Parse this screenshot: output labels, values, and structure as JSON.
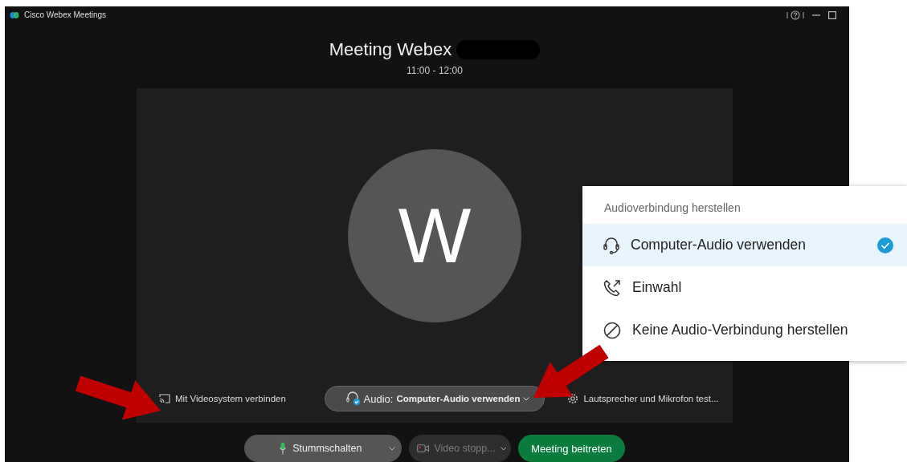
{
  "window": {
    "title": "Cisco Webex Meetings"
  },
  "meeting": {
    "title": "Meeting Webex",
    "time": "11:00 - 12:00"
  },
  "avatar": {
    "initial": "W"
  },
  "preview_bar": {
    "video_system": "Mit Videosystem verbinden",
    "audio": {
      "label": "Audio:",
      "value": "Computer-Audio verwenden"
    },
    "test": "Lautsprecher und Mikrofon test..."
  },
  "actions": [
    {
      "kind": "mute",
      "label": "Stummschalten",
      "disabled": false
    },
    {
      "kind": "video",
      "label": "Video stopp...",
      "disabled": true
    },
    {
      "kind": "join",
      "label": "Meeting beitreten",
      "disabled": false
    }
  ],
  "audio_menu": {
    "title": "Audioverbindung herstellen",
    "options": [
      {
        "kind": "computer",
        "label": "Computer-Audio verwenden",
        "selected": true
      },
      {
        "kind": "dial",
        "label": "Einwahl",
        "selected": false
      },
      {
        "kind": "none",
        "label": "Keine Audio-Verbindung herstellen",
        "selected": false
      }
    ]
  }
}
